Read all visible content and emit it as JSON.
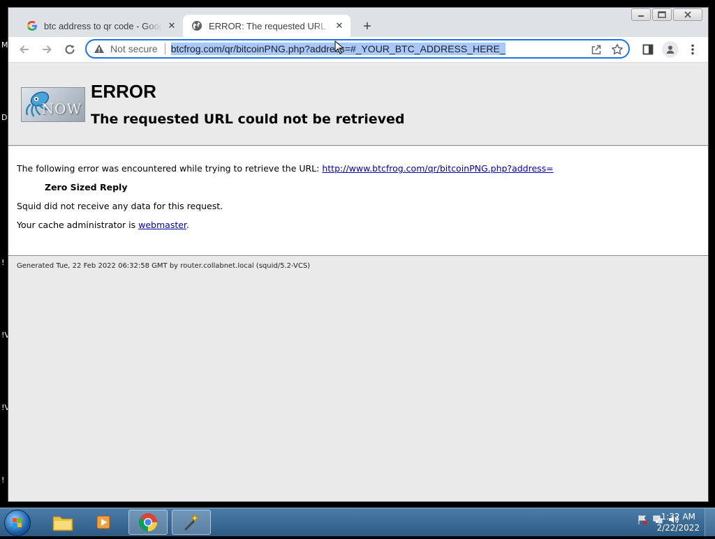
{
  "browser": {
    "tabs": [
      {
        "title": "btc address to qr code - Google Search",
        "favicon": "google-g-icon",
        "active": false
      },
      {
        "title": "ERROR: The requested URL could not be retrieved",
        "favicon": "globe-icon",
        "active": true
      }
    ],
    "omnibox": {
      "security_label": "Not secure",
      "url": "btcfrog.com/qr/bitcoinPNG.php?address=#_YOUR_BTC_ADDRESS_HERE_"
    }
  },
  "page": {
    "logo_text": "NOW",
    "error_title": "ERROR",
    "error_subtitle": "The requested URL could not be retrieved",
    "intro_text": "The following error was encountered while trying to retrieve the URL:",
    "intro_link": "http://www.btcfrog.com/qr/bitcoinPNG.php?address=",
    "error_name": "Zero Sized Reply",
    "error_detail": "Squid did not receive any data for this request.",
    "admin_text": "Your cache administrator is",
    "admin_link": "webmaster",
    "admin_suffix": ".",
    "footer": "Generated Tue, 22 Feb 2022 06:32:58 GMT by router.collabnet.local (squid/5.2-VCS)"
  },
  "desktop_edge_glyphs": [
    "M",
    "D",
    "!",
    "!V",
    "!V",
    "!"
  ],
  "taskbar": {
    "time": "1:32 AM",
    "date": "2/22/2022"
  },
  "colors": {
    "accent": "#1a73e8",
    "url_highlight": "#a8c7fa",
    "link": "#0000aa",
    "page_bg": "#eaeaea"
  }
}
